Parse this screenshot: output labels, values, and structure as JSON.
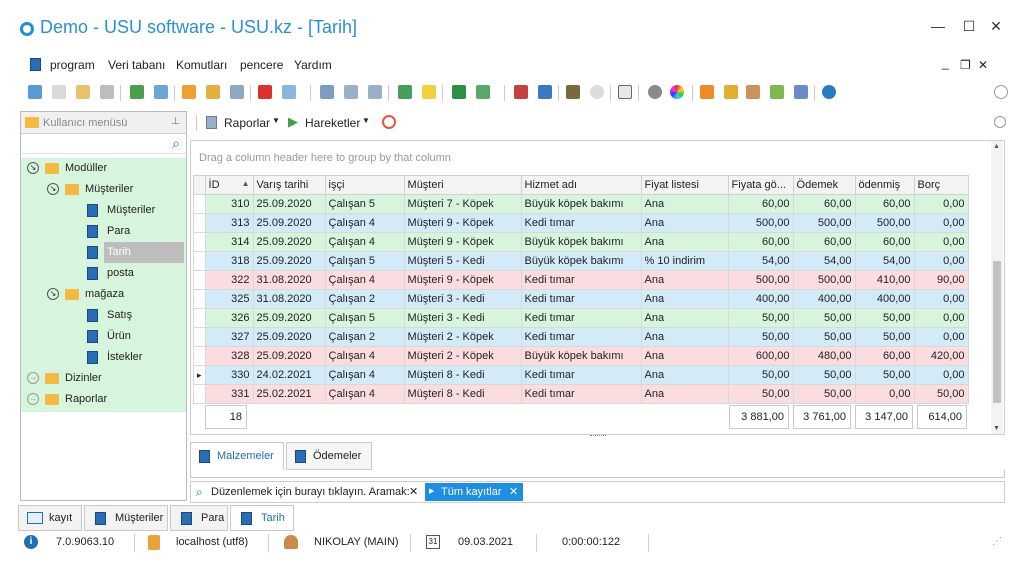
{
  "window": {
    "title": "Demo - USU software - USU.kz - [Tarih]",
    "minimize": "—",
    "maximize": "☐",
    "close": "✕"
  },
  "menu": [
    "program",
    "Veri tabanı",
    "Komutları",
    "pencere",
    "Yardım"
  ],
  "sidebar": {
    "header": "Kullanıcı menüsü",
    "items": [
      {
        "label": "Modüller",
        "type": "folder"
      },
      {
        "label": "Müşteriler",
        "type": "folder"
      },
      {
        "label": "Müşteriler",
        "type": "doc"
      },
      {
        "label": "Para",
        "type": "doc"
      },
      {
        "label": "Tarih",
        "type": "doc"
      },
      {
        "label": "posta",
        "type": "doc"
      },
      {
        "label": "mağaza",
        "type": "folder"
      },
      {
        "label": "Satış",
        "type": "doc"
      },
      {
        "label": "Ürün",
        "type": "doc"
      },
      {
        "label": "İstekler",
        "type": "doc"
      },
      {
        "label": "Dizinler",
        "type": "folder"
      },
      {
        "label": "Raporlar",
        "type": "folder"
      }
    ]
  },
  "right_toolbar": {
    "reports": "Raporlar",
    "moves": "Hareketler"
  },
  "grid": {
    "group_hint": "Drag a column header here to group by that column",
    "columns": [
      "İD",
      "Varış tarihi",
      "işçi",
      "Müşteri",
      "Hizmet adı",
      "Fiyat listesi",
      "Fiyata gö...",
      "Ödemek",
      "ödenmiş",
      "Borç"
    ],
    "rows": [
      {
        "style": "green",
        "cells": [
          "310",
          "25.09.2020",
          "Çalışan 5",
          "Müşteri 7 - Köpek",
          "Büyük köpek bakımı",
          "Ana",
          "60,00",
          "60,00",
          "60,00",
          "0,00"
        ]
      },
      {
        "style": "blue",
        "cells": [
          "313",
          "25.09.2020",
          "Çalışan 4",
          "Müşteri 9 - Köpek",
          "Kedi tımar",
          "Ana",
          "500,00",
          "500,00",
          "500,00",
          "0,00"
        ]
      },
      {
        "style": "green",
        "cells": [
          "314",
          "25.09.2020",
          "Çalışan 4",
          "Müşteri 9 - Köpek",
          "Büyük köpek bakımı",
          "Ana",
          "60,00",
          "60,00",
          "60,00",
          "0,00"
        ]
      },
      {
        "style": "blue",
        "cells": [
          "318",
          "25.09.2020",
          "Çalışan 5",
          "Müşteri 5 - Kedi",
          "Büyük köpek bakımı",
          "% 10 indirim",
          "54,00",
          "54,00",
          "54,00",
          "0,00"
        ]
      },
      {
        "style": "pink",
        "cells": [
          "322",
          "31.08.2020",
          "Çalışan 4",
          "Müşteri 9 - Köpek",
          "Kedi tımar",
          "Ana",
          "500,00",
          "500,00",
          "410,00",
          "90,00"
        ]
      },
      {
        "style": "blue",
        "cells": [
          "325",
          "31.08.2020",
          "Çalışan 2",
          "Müşteri 3 - Kedi",
          "Kedi tımar",
          "Ana",
          "400,00",
          "400,00",
          "400,00",
          "0,00"
        ]
      },
      {
        "style": "green",
        "cells": [
          "326",
          "25.09.2020",
          "Çalışan 5",
          "Müşteri 3 - Kedi",
          "Kedi tımar",
          "Ana",
          "50,00",
          "50,00",
          "50,00",
          "0,00"
        ]
      },
      {
        "style": "blue",
        "cells": [
          "327",
          "25.09.2020",
          "Çalışan 2",
          "Müşteri 2 - Köpek",
          "Kedi tımar",
          "Ana",
          "50,00",
          "50,00",
          "50,00",
          "0,00"
        ]
      },
      {
        "style": "pink",
        "cells": [
          "328",
          "25.09.2020",
          "Çalışan 4",
          "Müşteri 2 - Köpek",
          "Büyük köpek bakımı",
          "Ana",
          "600,00",
          "480,00",
          "60,00",
          "420,00"
        ]
      },
      {
        "style": "blue",
        "cells": [
          "330",
          "24.02.2021",
          "Çalışan 4",
          "Müşteri 8 - Kedi",
          "Kedi tımar",
          "Ana",
          "50,00",
          "50,00",
          "50,00",
          "0,00"
        ]
      },
      {
        "style": "pink",
        "cells": [
          "331",
          "25.02.2021",
          "Çalışan 4",
          "Müşteri 8 - Kedi",
          "Kedi tımar",
          "Ana",
          "50,00",
          "50,00",
          "0,00",
          "50,00"
        ]
      }
    ],
    "footer": {
      "count": "18",
      "total_price": "3 881,00",
      "total_pay": "3 761,00",
      "total_paid": "3 147,00",
      "total_debt": "614,00"
    }
  },
  "detail_tabs": [
    "Malzemeler",
    "Ödemeler"
  ],
  "filter": {
    "search_hint": "Düzenlemek için burayı tıklayın. Aramak:",
    "chip": "Tüm kayıtlar"
  },
  "bottom_tabs": [
    "kayıt",
    "Müşteriler",
    "Para",
    "Tarih"
  ],
  "status": {
    "version": "7.0.9063.10",
    "db": "localhost (utf8)",
    "user": "NIKOLAY (MAIN)",
    "date": "09.03.2021",
    "timer": "0:00:00:122"
  },
  "colors": {
    "accent": "#2b8fd6",
    "row_green": "#d6f5dc",
    "row_blue": "#d3ebf8",
    "row_pink": "#fbdde0"
  }
}
